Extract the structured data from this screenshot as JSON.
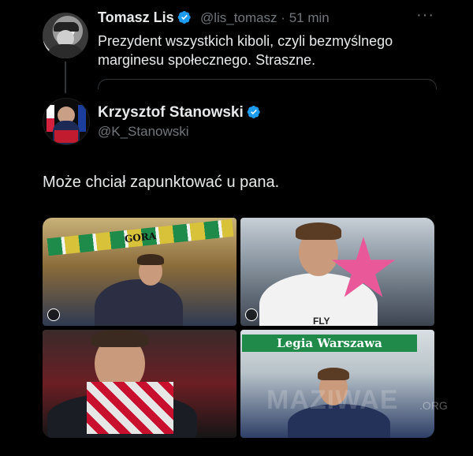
{
  "tweet1": {
    "display_name": "Tomasz Lis",
    "handle": "@lis_tomasz",
    "separator": "·",
    "time": "51 min",
    "more": "···",
    "text_line1": "Prezydent wszystkich kiboli, czyli bezmyślnego",
    "text_line2": "marginesu społecznego. Straszne."
  },
  "tweet2": {
    "display_name": "Krzysztof Stanowski",
    "handle": "@K_Stanowski",
    "text": "Może chciał zapunktować u pana."
  },
  "photos": {
    "p1_scarf_text": "GORA",
    "p2_jersey_text": "FLY",
    "p4_scarf_text": "Legia Warszawa"
  },
  "watermark": {
    "text": "MAZIWAE",
    "suffix": ".ORG"
  },
  "colors": {
    "background": "#000000",
    "verified_blue": "#1d9bf0",
    "muted_text": "#71767b",
    "star_pink": "#e9599a",
    "legia_green": "#1f8a49"
  },
  "icons": {
    "verified": "verified-badge-icon",
    "more": "more-options-icon"
  }
}
